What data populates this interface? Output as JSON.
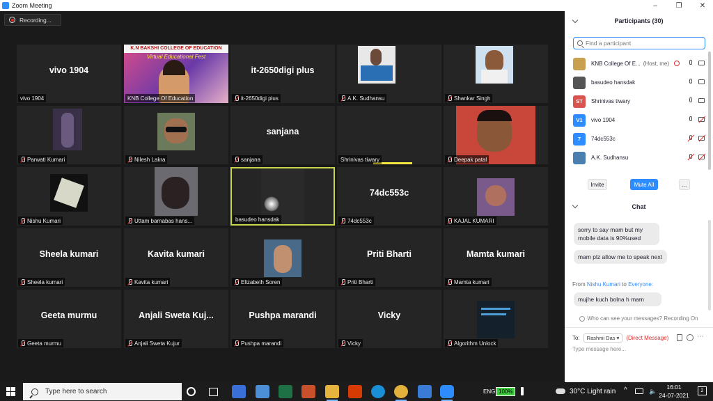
{
  "window": {
    "title": "Zoom Meeting",
    "controls": [
      "–",
      "❐",
      "✕"
    ]
  },
  "recording": {
    "label": "Recording..."
  },
  "tiles": [
    {
      "big": "vivo 1904",
      "label": "vivo 1904",
      "muted": false
    },
    {
      "big": "",
      "label": "KNB College Of Education",
      "muted": false,
      "banner": "K.N BAKSHI COLLEGE OF EDUCATION",
      "banner2": "Virtual Educational Fest"
    },
    {
      "big": "it-2650digi plus",
      "label": "it-2650digi plus",
      "muted": true
    },
    {
      "big": "",
      "label": "A.K. Sudhansu",
      "muted": true
    },
    {
      "big": "",
      "label": "Shankar Singh",
      "muted": true
    },
    {
      "big": "",
      "label": "Parwati Kumari",
      "muted": true
    },
    {
      "big": "",
      "label": "Nilesh Lakra",
      "muted": true
    },
    {
      "big": "sanjana",
      "label": "sanjana",
      "muted": true
    },
    {
      "big": "",
      "label": "Shrinivas tiwary",
      "muted": false
    },
    {
      "big": "",
      "label": "Deepak patal",
      "muted": true
    },
    {
      "big": "",
      "label": "Nishu Kumari",
      "muted": true
    },
    {
      "big": "",
      "label": "Uttam barnabas hans...",
      "muted": true
    },
    {
      "big": "",
      "label": "basudeo hansdak",
      "muted": false
    },
    {
      "big": "74dc553c",
      "label": "74dc553c",
      "muted": true
    },
    {
      "big": "",
      "label": "KAJAL KUMARI",
      "muted": true
    },
    {
      "big": "Sheela kumari",
      "label": "Sheela kumari",
      "muted": true
    },
    {
      "big": "Kavita kumari",
      "label": "Kavita kumari",
      "muted": true
    },
    {
      "big": "",
      "label": "Elizabeth Soren",
      "muted": true
    },
    {
      "big": "Priti Bharti",
      "label": "Priti Bharti",
      "muted": true
    },
    {
      "big": "Mamta kumari",
      "label": "Mamta kumari",
      "muted": true
    },
    {
      "big": "Geeta murmu",
      "label": "Geeta murmu",
      "muted": true
    },
    {
      "big": "Anjali  Sweta  Kuj...",
      "label": "Anjali Sweta Kujur",
      "muted": true
    },
    {
      "big": "Pushpa marandi",
      "label": "Pushpa marandi",
      "muted": true
    },
    {
      "big": "Vicky",
      "label": "Vicky",
      "muted": true
    },
    {
      "big": "",
      "label": "Algorithm Unlock",
      "muted": true
    }
  ],
  "participants": {
    "title": "Participants (30)",
    "search_placeholder": "Find a participant",
    "list": [
      {
        "avatar": "",
        "avatar_color": "#c8a050",
        "name": "KNB College Of E...",
        "tag": "(Host, me)",
        "mic_off": false,
        "cam_off": false
      },
      {
        "avatar": "",
        "avatar_color": "#555555",
        "name": "basudeo hansdak",
        "tag": "",
        "mic_off": false,
        "cam_off": false
      },
      {
        "avatar": "ST",
        "avatar_color": "#d9534f",
        "name": "Shrinivas tiwary",
        "tag": "",
        "mic_off": false,
        "cam_off": false
      },
      {
        "avatar": "V1",
        "avatar_color": "#2d8cff",
        "name": "vivo 1904",
        "tag": "",
        "mic_off": false,
        "cam_off": true
      },
      {
        "avatar": "7",
        "avatar_color": "#2d8cff",
        "name": "74dc553c",
        "tag": "",
        "mic_off": true,
        "cam_off": true
      },
      {
        "avatar": "",
        "avatar_color": "#4a7fb0",
        "name": "A.K. Sudhansu",
        "tag": "",
        "mic_off": true,
        "cam_off": true
      }
    ],
    "buttons": {
      "invite": "Invite",
      "mute_all": "Mute All",
      "more": "..."
    }
  },
  "chat": {
    "title": "Chat",
    "messages": [
      {
        "text": "sorry to say mam but my mobile data is 90%used"
      },
      {
        "text": "mam plz allow me to speak next"
      },
      {
        "text": "mujhe kuch bolna h mam"
      }
    ],
    "from_line": {
      "prefix": "From",
      "sender": "Nishu Kumari",
      "to": "to",
      "recipient": "Everyone:"
    },
    "who_can_see": "Who can see your messages? Recording On",
    "to_label": "To:",
    "to_value": "Rashmi Das",
    "direct": "(Direct Message)",
    "input_placeholder": "Type message here..."
  },
  "taskbar": {
    "search_placeholder": "Type here to search",
    "lang": "ENG",
    "battery": "100%",
    "weather": "30°C  Light rain",
    "time": "16:01",
    "date": "24-07-2021",
    "notif_count": "2"
  },
  "colors": {
    "zoom_blue": "#2d8cff",
    "active_speaker": "#c8d74a",
    "muted_red": "#e03b3b"
  }
}
